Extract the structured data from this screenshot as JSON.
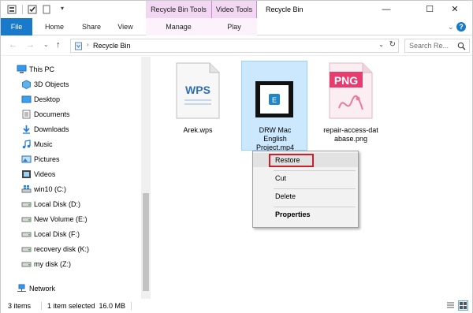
{
  "titlebar": {
    "title": "Recycle Bin",
    "contextual_tabs": [
      "Recycle Bin Tools",
      "Video Tools"
    ],
    "minimize": "—",
    "maximize": "☐",
    "close": "✕"
  },
  "ribbon": {
    "tabs": [
      "File",
      "Home",
      "Share",
      "View",
      "Manage",
      "Play"
    ]
  },
  "address": {
    "path": "Recycle Bin",
    "search_placeholder": "Search Re..."
  },
  "nav": {
    "items": [
      {
        "label": "This PC",
        "icon": "pc-icon"
      },
      {
        "label": "3D Objects",
        "icon": "cube-icon"
      },
      {
        "label": "Desktop",
        "icon": "desktop-icon"
      },
      {
        "label": "Documents",
        "icon": "documents-icon"
      },
      {
        "label": "Downloads",
        "icon": "downloads-icon"
      },
      {
        "label": "Music",
        "icon": "music-icon"
      },
      {
        "label": "Pictures",
        "icon": "pictures-icon"
      },
      {
        "label": "Videos",
        "icon": "videos-icon"
      },
      {
        "label": "win10 (C:)",
        "icon": "drive-icon"
      },
      {
        "label": "Local Disk (D:)",
        "icon": "drive-icon"
      },
      {
        "label": "New Volume (E:)",
        "icon": "drive-icon"
      },
      {
        "label": "Local Disk (F:)",
        "icon": "drive-icon"
      },
      {
        "label": "recovery disk (K:)",
        "icon": "drive-icon"
      },
      {
        "label": "my disk (Z:)",
        "icon": "drive-icon"
      },
      {
        "label": "Network",
        "icon": "network-icon"
      }
    ]
  },
  "files": [
    {
      "name": "Arek.wps",
      "icon_text": "WPS"
    },
    {
      "name_lines": [
        "DRW Mac",
        "English",
        "Project.mp4"
      ],
      "icon_text": "E"
    },
    {
      "name_lines": [
        "repair-access-dat",
        "abase.png"
      ],
      "icon_text": "PNG"
    }
  ],
  "context_menu": {
    "items": [
      "Restore",
      "Cut",
      "Delete",
      "Properties"
    ]
  },
  "status": {
    "count": "3 items",
    "selection": "1 item selected  16.0 MB"
  },
  "colors": {
    "accent": "#1979ca",
    "context_tab": "#f1d7f1",
    "selection": "#cce8ff",
    "highlight_box": "#cc1f2a"
  }
}
